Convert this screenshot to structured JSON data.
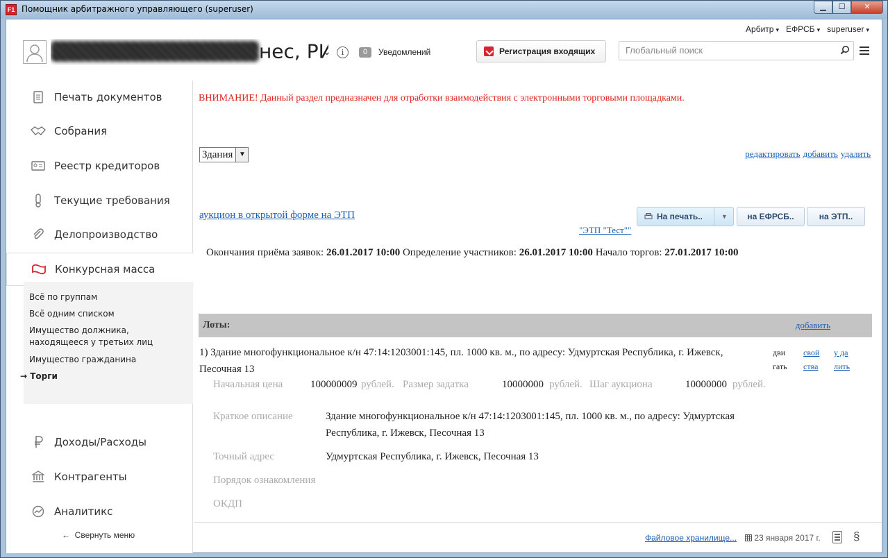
{
  "window": {
    "title": "Помощник арбитражного управляющего (superuser)",
    "minimize": "▁",
    "maximize": "☐",
    "close": "✕",
    "app_icon": "F1"
  },
  "header": {
    "topright": [
      {
        "label": "Арбитр",
        "caret": "▾"
      },
      {
        "label": "ЕФРСБ",
        "caret": "▾"
      },
      {
        "label": "superuser",
        "caret": "▾"
      }
    ],
    "org_suffix": "нес, РИ",
    "org_caret": "⌄",
    "info": "i",
    "notifications_count": "0",
    "notifications_label": "Уведомлений",
    "register_button": "Регистрация входящих",
    "search_placeholder": "Глобальный поиск"
  },
  "sidebar": {
    "items": [
      {
        "label": "Печать документов",
        "icon": "document-icon"
      },
      {
        "label": "Собрания",
        "icon": "handshake-icon"
      },
      {
        "label": "Реестр кредиторов",
        "icon": "id-card-icon"
      },
      {
        "label": "Текущие требования",
        "icon": "thermometer-icon"
      },
      {
        "label": "Делопроизводство",
        "icon": "paperclip-icon"
      },
      {
        "label": "Конкурсная масса",
        "icon": "wallet-icon"
      },
      {
        "label": "Доходы/Расходы",
        "icon": "ruble-icon"
      },
      {
        "label": "Контрагенты",
        "icon": "bank-icon"
      },
      {
        "label": "Аналитикс",
        "icon": "analytics-icon"
      }
    ],
    "subitems": [
      "Всё по группам",
      "Всё одним списком",
      "Имущество должника, находящееся у третьих лиц",
      "Имущество гражданина",
      "Торги"
    ],
    "current_marker": "→",
    "collapse": "Свернуть меню",
    "collapse_arrow": "←"
  },
  "content": {
    "warning": "ВНИМАНИЕ! Данный раздел предназначен для отработки взаимодействия с электронными торговыми площадками.",
    "select_value": "Здания",
    "edit_links": [
      "редактировать",
      "добавить",
      "удалить"
    ],
    "auction_link": "аукцион в открытой форме на ЭТП",
    "etp_link": "\"ЭТП \"Тест\"\"",
    "print_button": "На печать..",
    "efrsb_button": "на ЕФРСБ..",
    "etp_button": "на ЭТП..",
    "dates": {
      "deadline_label": "Окончания приёма заявок:",
      "deadline": "26.01.2017 10:00",
      "participants_label": "Определение участников:",
      "participants": "26.01.2017 10:00",
      "start_label": "Начало торгов:",
      "start": "27.01.2017 10:00"
    },
    "lots_label": "Лоты:",
    "lots_add": "добавить",
    "lot": {
      "title": "1) Здание многофункциональное к/н 47:14:1203001:145, пл. 1000 кв. м., по адресу: Удмуртская Республика, г. Ижевск, Песочная 13",
      "actions": [
        {
          "line1": "дви",
          "line2": "гать"
        },
        {
          "line1": "свой",
          "line2": "ства"
        },
        {
          "line1": "у да",
          "line2": "лить"
        }
      ],
      "start_price_label": "Начальная цена",
      "start_price": "100000009",
      "currency": "рублей.",
      "deposit_label": "Размер задатка",
      "deposit": "10000000",
      "step_label": "Шаг аукциона",
      "step": "10000000",
      "desc_label": "Краткое описание",
      "desc": "Здание многофункциональное к/н 47:14:1203001:145, пл. 1000 кв. м., по адресу: Удмуртская Республика, г. Ижевск, Песочная 13",
      "address_label": "Точный адрес",
      "address": "Удмуртская Республика, г. Ижевск, Песочная 13",
      "order_label": "Порядок ознакомления",
      "okdp_label": "ОКДП"
    }
  },
  "footer": {
    "file_storage": "Файловое хранилище...",
    "date": "23 января 2017 г.",
    "section_sign": "§"
  }
}
